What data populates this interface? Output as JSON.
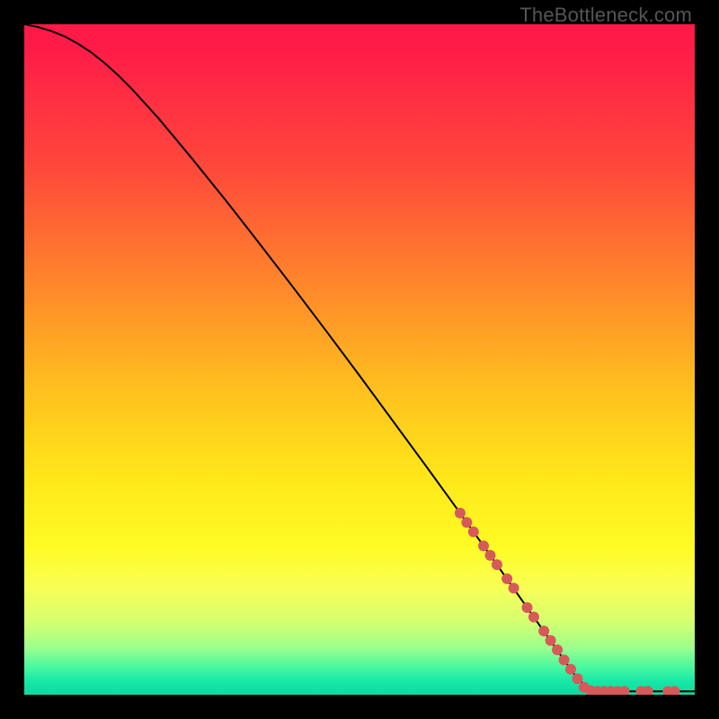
{
  "watermark": "TheBottleneck.com",
  "chart_data": {
    "type": "line",
    "title": "",
    "xlabel": "",
    "ylabel": "",
    "xlim": [
      0,
      100
    ],
    "ylim": [
      0,
      100
    ],
    "curve": {
      "name": "bottleneck-curve",
      "color": "#000000",
      "x": [
        0,
        2,
        4,
        6,
        8,
        10,
        12,
        14,
        16,
        20,
        25,
        30,
        35,
        40,
        45,
        50,
        55,
        60,
        65,
        70,
        75,
        80,
        82,
        84,
        86,
        88,
        90,
        92,
        94,
        96,
        98,
        100
      ],
      "y": [
        100,
        99.6,
        99.0,
        98.2,
        97.1,
        95.8,
        94.2,
        92.4,
        90.4,
        86.0,
        80.0,
        73.8,
        67.4,
        60.9,
        54.3,
        47.6,
        40.8,
        34.0,
        27.1,
        20.1,
        13.0,
        5.9,
        3.1,
        0.9,
        0.6,
        0.5,
        0.5,
        0.5,
        0.5,
        0.5,
        0.5,
        0.5
      ]
    },
    "markers": {
      "name": "highlighted-points",
      "color": "#d65a5a",
      "radius": 6,
      "points": [
        {
          "x": 65.0,
          "y": 27.1
        },
        {
          "x": 66.0,
          "y": 25.7
        },
        {
          "x": 67.0,
          "y": 24.3
        },
        {
          "x": 68.5,
          "y": 22.2
        },
        {
          "x": 69.5,
          "y": 20.8
        },
        {
          "x": 70.5,
          "y": 19.4
        },
        {
          "x": 72.0,
          "y": 17.3
        },
        {
          "x": 73.0,
          "y": 15.9
        },
        {
          "x": 75.0,
          "y": 13.0
        },
        {
          "x": 76.0,
          "y": 11.6
        },
        {
          "x": 77.5,
          "y": 9.5
        },
        {
          "x": 78.5,
          "y": 8.1
        },
        {
          "x": 79.5,
          "y": 6.7
        },
        {
          "x": 80.5,
          "y": 5.2
        },
        {
          "x": 81.5,
          "y": 3.8
        },
        {
          "x": 82.5,
          "y": 2.4
        },
        {
          "x": 83.5,
          "y": 1.1
        },
        {
          "x": 84.5,
          "y": 0.6
        },
        {
          "x": 85.5,
          "y": 0.5
        },
        {
          "x": 86.5,
          "y": 0.5
        },
        {
          "x": 87.5,
          "y": 0.5
        },
        {
          "x": 88.5,
          "y": 0.5
        },
        {
          "x": 89.5,
          "y": 0.5
        },
        {
          "x": 92.0,
          "y": 0.5
        },
        {
          "x": 93.0,
          "y": 0.5
        },
        {
          "x": 96.0,
          "y": 0.5
        },
        {
          "x": 97.0,
          "y": 0.5
        }
      ]
    }
  }
}
